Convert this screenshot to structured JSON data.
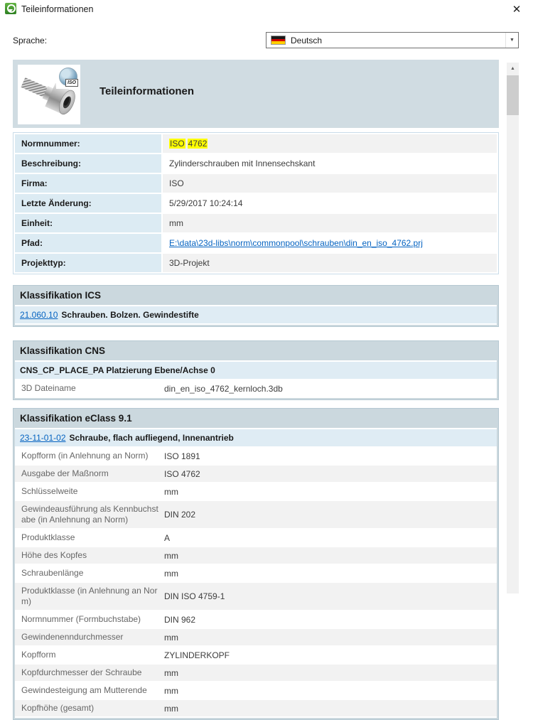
{
  "window": {
    "title": "Teileinformationen"
  },
  "icons": {
    "close": "✕",
    "dropdown_arrow": "▼",
    "scroll_up": "▲"
  },
  "language": {
    "label": "Sprache:",
    "selected": "Deutsch"
  },
  "header": {
    "title": "Teileinformationen",
    "badge": "ISO"
  },
  "info_table": {
    "rows": [
      {
        "label": "Normnummer:",
        "value_parts": [
          "ISO",
          "4762"
        ]
      },
      {
        "label": "Beschreibung:",
        "value": "Zylinderschrauben mit Innensechskant"
      },
      {
        "label": "Firma:",
        "value": "ISO"
      },
      {
        "label": "Letzte Änderung:",
        "value": "5/29/2017 10:24:14"
      },
      {
        "label": "Einheit:",
        "value": "mm"
      },
      {
        "label": "Pfad:",
        "value": "E:\\data\\23d-libs\\norm\\commonpool\\schrauben\\din_en_iso_4762.prj"
      },
      {
        "label": "Projekttyp:",
        "value": "3D-Projekt"
      }
    ]
  },
  "sections": {
    "ics": {
      "title": "Klassifikation ICS",
      "code": "21.060.10",
      "text": "Schrauben. Bolzen. Gewindestifte"
    },
    "cns": {
      "title": "Klassifikation CNS",
      "subheader": "CNS_CP_PLACE_PA Platzierung Ebene/Achse 0",
      "rows": [
        {
          "label": "3D Dateiname",
          "value": "din_en_iso_4762_kernloch.3db"
        }
      ]
    },
    "eclass": {
      "title": "Klassifikation eClass 9.1",
      "code": "23-11-01-02",
      "text": "Schraube, flach aufliegend, Innenantrieb",
      "rows": [
        {
          "label": "Kopfform (in Anlehnung an Norm)",
          "value": "ISO 1891"
        },
        {
          "label": "Ausgabe der Maßnorm",
          "value": "ISO 4762"
        },
        {
          "label": "Schlüsselweite",
          "value": "mm"
        },
        {
          "label": "Gewindeausführung als Kennbuchstabe (in Anlehnung an Norm)",
          "value": "DIN 202"
        },
        {
          "label": "Produktklasse",
          "value": "A"
        },
        {
          "label": "Höhe des Kopfes",
          "value": "mm"
        },
        {
          "label": "Schraubenlänge",
          "value": "mm"
        },
        {
          "label": "Produktklasse (in Anlehnung an Norm)",
          "value": "DIN ISO 4759-1"
        },
        {
          "label": "Normnummer (Formbuchstabe)",
          "value": "DIN 962"
        },
        {
          "label": "Gewindenenndurchmesser",
          "value": "mm"
        },
        {
          "label": "Kopfform",
          "value": "ZYLINDERKOPF"
        },
        {
          "label": "Kopfdurchmesser der Schraube",
          "value": "mm"
        },
        {
          "label": "Gewindesteigung am Mutterende",
          "value": "mm"
        },
        {
          "label": "Kopfhöhe (gesamt)",
          "value": "mm"
        }
      ]
    }
  },
  "colors": {
    "section_bg": "#cbd8de",
    "header_band_bg": "#d0dce2",
    "label_column_bg": "#dcebf3",
    "light_blue_row_bg": "#dfecf4",
    "alt_row_bg": "#f2f2f2",
    "highlight": "#ffff00",
    "link": "#0563c1",
    "app_icon_green": "#43a047"
  }
}
